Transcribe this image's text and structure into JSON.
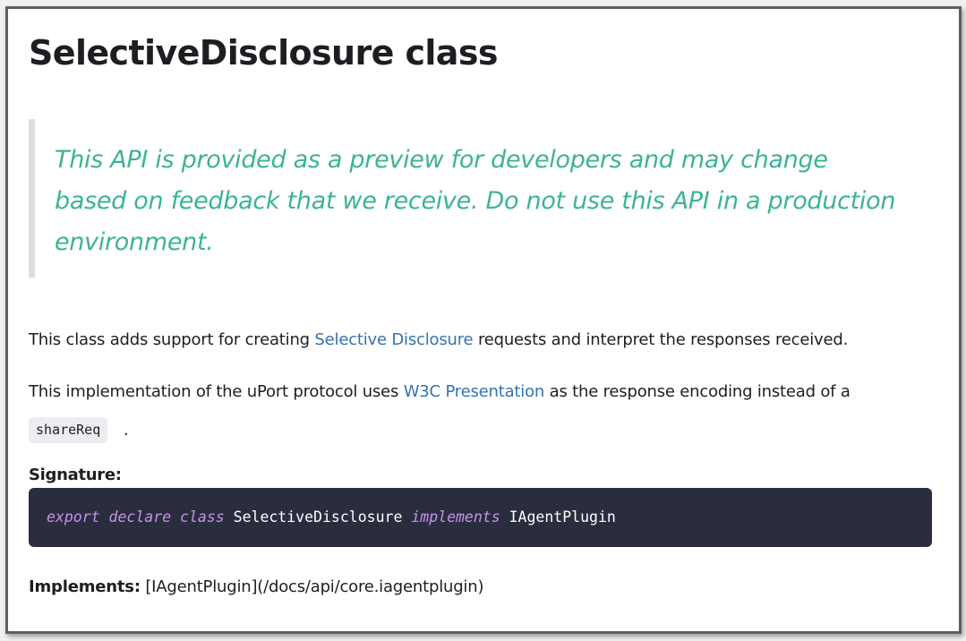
{
  "page_title": "SelectiveDisclosure class",
  "notice": {
    "text": "This API is provided as a preview for developers and may change based on feedback that we receive. Do not use this API in a production environment."
  },
  "paragraph1": {
    "before": "This class adds support for creating ",
    "link": "Selective Disclosure",
    "after": " requests and interpret the responses received."
  },
  "paragraph2": {
    "before": "This implementation of the uPort protocol uses ",
    "link": "W3C Presentation",
    "after": " as the response encoding instead of a",
    "inline_code": "shareReq",
    "period": "."
  },
  "signature": {
    "label": "Signature:",
    "code": {
      "kw1": "export",
      "kw2": "declare",
      "kw3": "class",
      "name": "SelectiveDisclosure",
      "kw4": "implements",
      "iface": "IAgentPlugin"
    }
  },
  "implements": {
    "label": "Implements:",
    "value": "[IAgentPlugin](/docs/api/core.iagentplugin)"
  },
  "colors": {
    "notice_text": "#3db396",
    "link": "#3572b0",
    "code_bg": "#292d3e",
    "code_keyword": "#c792ea"
  }
}
